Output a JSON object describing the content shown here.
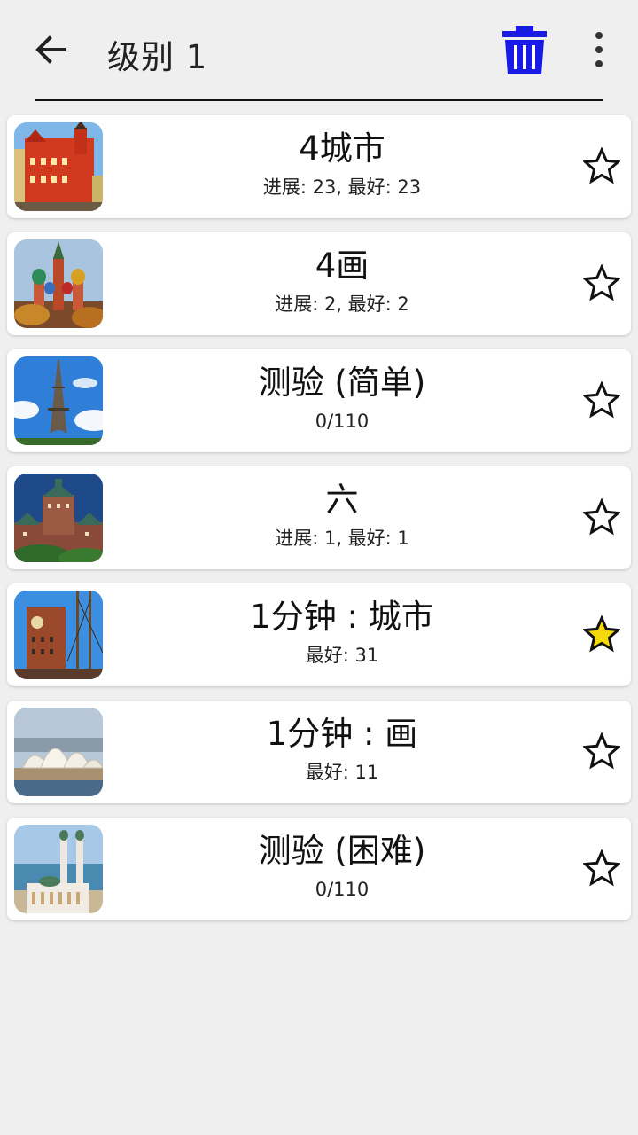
{
  "header": {
    "title": "级别 1",
    "back_icon": "arrow-left-icon",
    "trash_icon": "trash-icon",
    "more_icon": "more-vert-icon",
    "trash_color": "#1a1ae6"
  },
  "items": [
    {
      "title": "4城市",
      "subtitle": "进展: 23, 最好: 23",
      "starred": false,
      "image": "red-town-hall"
    },
    {
      "title": "4画",
      "subtitle": "进展: 2, 最好: 2",
      "starred": false,
      "image": "st-basils-cathedral"
    },
    {
      "title": "测验 (简单)",
      "subtitle": "0/110",
      "starred": false,
      "image": "eiffel-tower"
    },
    {
      "title": "六",
      "subtitle": "进展: 1, 最好: 1",
      "starred": false,
      "image": "chateau-frontenac"
    },
    {
      "title": "1分钟 : 城市",
      "subtitle": "最好: 31",
      "starred": true,
      "image": "oslo-city-hall"
    },
    {
      "title": "1分钟 : 画",
      "subtitle": "最好: 11",
      "starred": false,
      "image": "sydney-opera-house"
    },
    {
      "title": "测验 (困难)",
      "subtitle": "0/110",
      "starred": false,
      "image": "mosque-by-sea"
    }
  ],
  "colors": {
    "star_fill": "#f5d90a",
    "star_stroke": "#111111"
  }
}
